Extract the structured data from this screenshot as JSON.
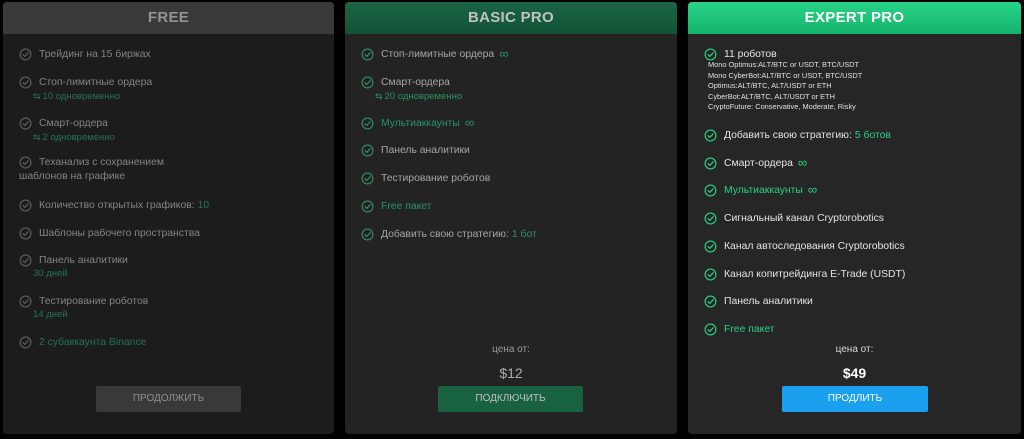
{
  "colors": {
    "accent_green": "#29d184",
    "blue_button": "#1aa0ee"
  },
  "icons": {
    "check": "check-circle-icon",
    "infinity": "infinity-icon",
    "arrows": "swap-arrows-icon"
  },
  "free": {
    "title": "FREE",
    "items": [
      {
        "text": "Трейдинг на 15 биржах"
      },
      {
        "text": "Стоп-лимитные ордера",
        "sub": "10 одновременно"
      },
      {
        "text": "Смарт-ордера",
        "sub": "2 одновременно"
      },
      {
        "text": "Теханализ с сохранением",
        "text2": "шаблонов на графике"
      },
      {
        "text": "Количество открытых графиков: ",
        "value": "10"
      },
      {
        "text": "Шаблоны рабочего пространства"
      },
      {
        "text": "Панель аналитики",
        "sub": "30 дней"
      },
      {
        "text": "Тестирование роботов",
        "sub": "14 дней"
      },
      {
        "text": "2 субаккаунта Binance"
      }
    ],
    "button": "ПРОДОЛЖИТЬ"
  },
  "basic": {
    "title": "BASIC PRO",
    "items": [
      {
        "text": "Стоп-лимитные ордера",
        "infinity": "∞"
      },
      {
        "text": "Смарт-ордера",
        "sub": "20 одновременно"
      },
      {
        "text": "Мультиаккаунты",
        "infinity": "∞"
      },
      {
        "text": "Панель аналитики"
      },
      {
        "text": "Тестирование роботов"
      },
      {
        "text": "Free пакет"
      },
      {
        "text": "Добавить свою стратегию: ",
        "value": "1 бот"
      }
    ],
    "price_label": "цена от:",
    "price": "$12",
    "button": "ПОДКЛЮЧИТЬ"
  },
  "expert": {
    "title": "EXPERT PRO",
    "robots_title": "11 роботов",
    "robots": [
      "Mono Optimus:ALT/BTC or USDT, BTC/USDT",
      "Mono CyberBot:ALT/BTC or USDT, BTC/USDT",
      "Optimus:ALT/BTC, ALT/USDT or ETH",
      "CyberBot:ALT/BTC, ALT/USDT or ETH",
      "CryptoFuture: Conservative, Moderate, Risky"
    ],
    "items": [
      {
        "text": "Добавить свою стратегию: ",
        "value": "5 ботов"
      },
      {
        "text": "Смарт-ордера",
        "infinity": "∞"
      },
      {
        "text": "Мультиаккаунты",
        "infinity": "∞"
      },
      {
        "text": "Сигнальный канал Cryptorobotics"
      },
      {
        "text": "Канал автоследования Cryptorobotics"
      },
      {
        "text": "Канал копитрейдинга E-Trade (USDT)"
      },
      {
        "text": "Панель аналитики"
      },
      {
        "text": "Free пакет"
      }
    ],
    "price_label": "цена от:",
    "price": "$49",
    "button": "ПРОДЛИТЬ"
  }
}
